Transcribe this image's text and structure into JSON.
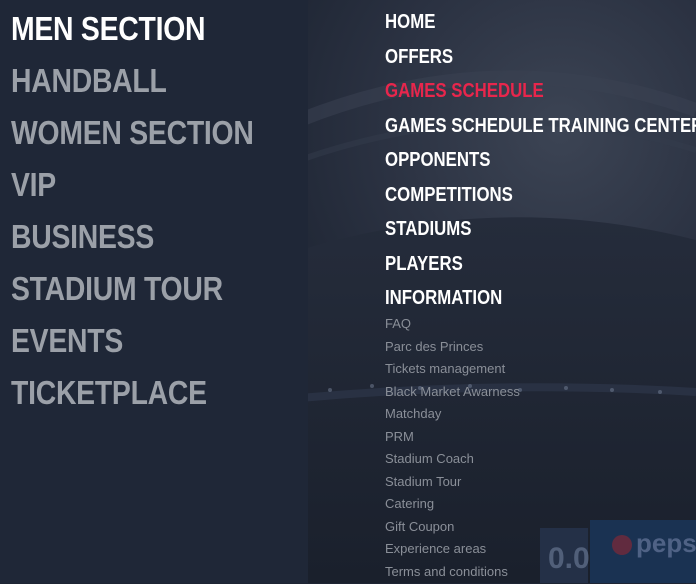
{
  "sections": [
    {
      "label": "MEN SECTION",
      "active": true
    },
    {
      "label": "HANDBALL",
      "active": false
    },
    {
      "label": "WOMEN SECTION",
      "active": false
    },
    {
      "label": "VIP",
      "active": false
    },
    {
      "label": "BUSINESS",
      "active": false
    },
    {
      "label": "STADIUM TOUR",
      "active": false
    },
    {
      "label": "EVENTS",
      "active": false
    },
    {
      "label": "TICKETPLACE",
      "active": false
    }
  ],
  "menu": [
    {
      "label": "HOME",
      "highlight": false
    },
    {
      "label": "OFFERS",
      "highlight": false
    },
    {
      "label": "GAMES SCHEDULE",
      "highlight": true
    },
    {
      "label": "GAMES SCHEDULE TRAINING CENTER'S",
      "highlight": false
    },
    {
      "label": "OPPONENTS",
      "highlight": false
    },
    {
      "label": "COMPETITIONS",
      "highlight": false
    },
    {
      "label": "STADIUMS",
      "highlight": false
    },
    {
      "label": "PLAYERS",
      "highlight": false
    },
    {
      "label": "INFORMATION",
      "highlight": false
    }
  ],
  "information_links": [
    "FAQ",
    "Parc des Princes",
    "Tickets management",
    "Black Market Awarness",
    "Matchday",
    "PRM",
    "Stadium Coach",
    "Stadium Tour",
    "Catering",
    "Gift Coupon",
    "Experience areas",
    "Terms and conditions"
  ],
  "background": {
    "scoreboard_text": "0.0",
    "sponsor_text": "peps"
  },
  "colors": {
    "panel": "#1f2737",
    "overlay": "#1e2533",
    "active_section": "#ffffff",
    "inactive_section": "#9ba0a8",
    "menu_text": "#ffffff",
    "highlight": "#e8264c",
    "sub_link": "#8a8f98"
  }
}
